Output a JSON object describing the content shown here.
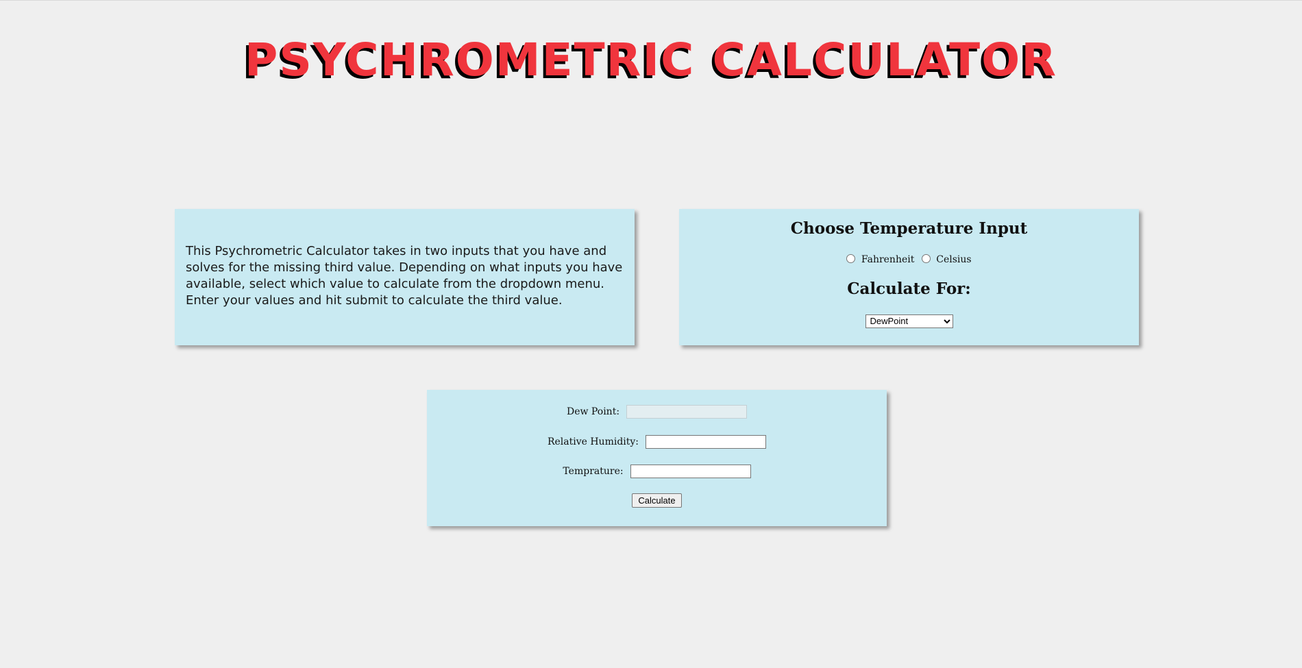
{
  "header": {
    "title": "PSYCHROMETRIC CALCULATOR"
  },
  "info": {
    "text": "This Psychrometric Calculator takes in two inputs that you have and solves for the missing third value. Depending on what inputs you have available, select which value to calculate from the dropdown menu. Enter your values and hit submit to calculate the third value."
  },
  "options": {
    "temperature_heading": "Choose Temperature Input",
    "units": [
      {
        "label": "Fahrenheit",
        "selected": false
      },
      {
        "label": "Celsius",
        "selected": false
      }
    ],
    "calculate_heading": "Calculate For:",
    "calculate_for_selected": "DewPoint"
  },
  "form": {
    "dew_point_label": "Dew Point:",
    "dew_point_value": "",
    "relative_humidity_label": "Relative Humidity:",
    "relative_humidity_value": "",
    "temperature_label": "Temprature:",
    "temperature_value": "",
    "calculate_button": "Calculate"
  },
  "colors": {
    "background": "#efefef",
    "panel": "#c9eaf2",
    "title": "#f0353d",
    "title_shadow": "#000000"
  }
}
